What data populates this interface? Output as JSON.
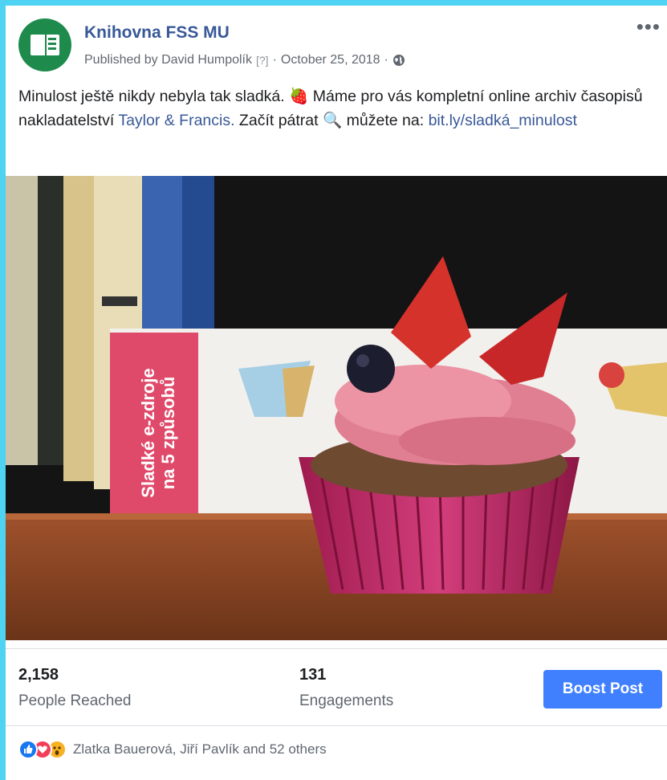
{
  "post": {
    "page_name": "Knihovna FSS MU",
    "published_by": "Published by David Humpolík",
    "help_marker": "[?]",
    "separator": "·",
    "date": "October 25, 2018",
    "privacy_icon": "globe-icon",
    "more_label": "•••",
    "text_part1": "Minulost ještě nikdy nebyla tak sladká. 🍓 Máme pro vás kompletní online archiv časopisů nakladatelství ",
    "text_link1": "Taylor & Francis.",
    "text_part2": " Začít pátrat 🔍 můžete na: ",
    "text_link2": "bit.ly/sladká_minulost",
    "image_banner_text_line1": "Sladké e-zdroje",
    "image_banner_text_line2": "na 5 způsobů"
  },
  "stats": {
    "reached_value": "2,158",
    "reached_label": "People Reached",
    "engagements_value": "131",
    "engagements_label": "Engagements",
    "boost_label": "Boost Post"
  },
  "reactions": {
    "icons": [
      "like-icon",
      "love-icon",
      "wow-icon"
    ],
    "names": "Zlatka Bauerová, Jiří Pavlík and 52 others"
  },
  "colors": {
    "link": "#385898",
    "boost": "#4080ff",
    "frame": "#4fd3f2"
  }
}
